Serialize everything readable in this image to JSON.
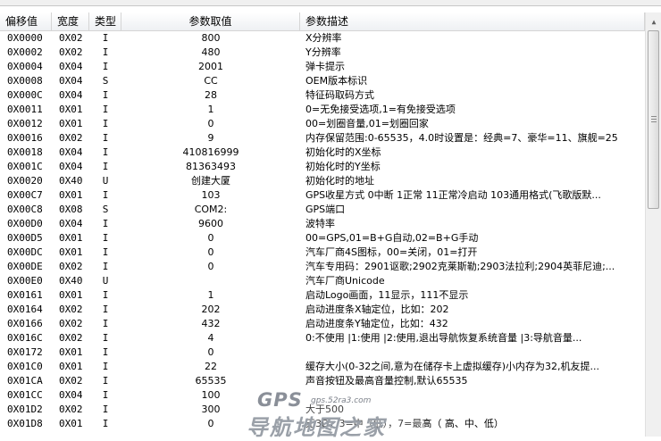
{
  "table": {
    "columns": [
      "偏移值",
      "宽度",
      "类型",
      "参数取值",
      "参数描述"
    ],
    "rows": [
      [
        "0X0000",
        "0X02",
        "I",
        "800",
        "X分辨率"
      ],
      [
        "0X0002",
        "0X02",
        "I",
        "480",
        "Y分辨率"
      ],
      [
        "0X0004",
        "0X04",
        "I",
        "2001",
        "弹卡提示"
      ],
      [
        "0X0008",
        "0X04",
        "S",
        "CC",
        "OEM版本标识"
      ],
      [
        "0X000C",
        "0X04",
        "I",
        "28",
        "特征码取码方式"
      ],
      [
        "0X0011",
        "0X01",
        "I",
        "1",
        "0=无免接受选项,1=有免接受选项"
      ],
      [
        "0X0012",
        "0X01",
        "I",
        "0",
        "00=划圈音量,01=划圈回家"
      ],
      [
        "0X0016",
        "0X02",
        "I",
        "9",
        "内存保留范围:0-65535，4.0时设置是：经典=7、豪华=11、旗舰=25"
      ],
      [
        "0X0018",
        "0X04",
        "I",
        "410816999",
        "初始化时的X坐标"
      ],
      [
        "0X001C",
        "0X04",
        "I",
        "81363493",
        "初始化时的Y坐标"
      ],
      [
        "0X0020",
        "0X40",
        "U",
        "创建大厦",
        "初始化时的地址"
      ],
      [
        "0X00C7",
        "0X01",
        "I",
        "103",
        "GPS收星方式 0中断 1正常 11正常冷启动 103通用格式(飞歌版默..."
      ],
      [
        "0X00C8",
        "0X08",
        "S",
        "COM2:",
        "GPS端口"
      ],
      [
        "0X00D0",
        "0X04",
        "I",
        "9600",
        "波特率"
      ],
      [
        "0X00D5",
        "0X01",
        "I",
        "0",
        "00=GPS,01=B+G自动,02=B+G手动"
      ],
      [
        "0X00DC",
        "0X01",
        "I",
        "0",
        "汽车厂商4S图标，00=关闭，01=打开"
      ],
      [
        "0X00DE",
        "0X02",
        "I",
        "0",
        "汽车专用码：2901讴歌;2902克莱斯勒;2903法拉利;2904英菲尼迪;..."
      ],
      [
        "0X00E0",
        "0X40",
        "U",
        "",
        "汽车厂商Unicode"
      ],
      [
        "0X0161",
        "0X01",
        "I",
        "1",
        "启动Logo画面，11显示，111不显示"
      ],
      [
        "0X0164",
        "0X02",
        "I",
        "202",
        "启动进度条X轴定位，比如：202"
      ],
      [
        "0X0166",
        "0X02",
        "I",
        "432",
        "启动进度条Y轴定位，比如：432"
      ],
      [
        "0X016C",
        "0X02",
        "I",
        "4",
        "0:不使用  |1:使用  |2:使用,退出导航恢复系统音量  |3:导航音量..."
      ],
      [
        "0X0172",
        "0X01",
        "I",
        "0",
        ""
      ],
      [
        "0X01C0",
        "0X01",
        "I",
        "22",
        "缓存大小(0-32之间,意为在储存卡上虚拟缓存)小内存为32,机友提..."
      ],
      [
        "0X01CA",
        "0X02",
        "I",
        "65535",
        "声音按钮及最高音量控制,默认65535"
      ],
      [
        "0X01CC",
        "0X04",
        "I",
        "100",
        ""
      ],
      [
        "0X01D2",
        "0X02",
        "I",
        "300",
        "大于500"
      ],
      [
        "0X01D8",
        "0X01",
        "I",
        "0",
        "无3D，3=中（低），7=最高（ 高、中、低）"
      ]
    ]
  },
  "watermark": {
    "logo_text": "GPS",
    "url": "gps.52ra3.com",
    "name": "导航地图之家"
  },
  "colors": {
    "header_bg": "#eef0f3",
    "grid": "#d5d5d5",
    "watermark": "#9aa0a8"
  },
  "scrollbar": {
    "icons": [
      "up-arrow-icon"
    ]
  }
}
